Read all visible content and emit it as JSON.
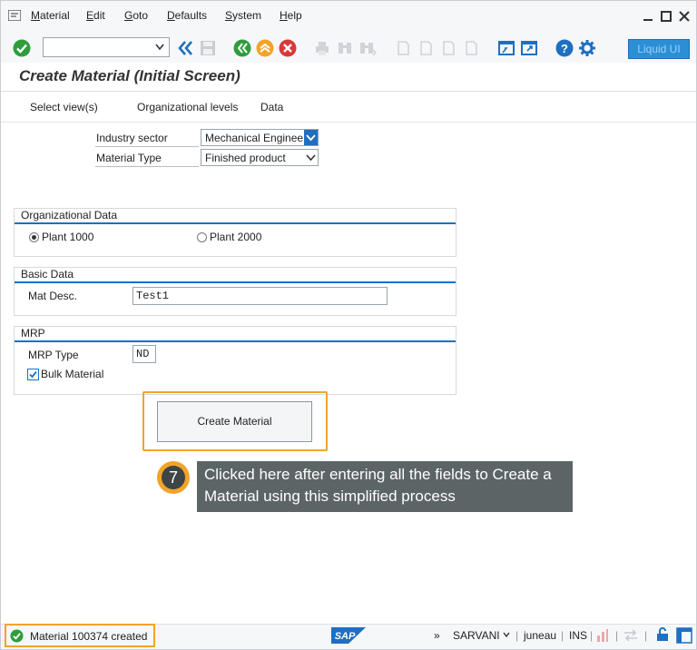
{
  "menubar": {
    "items": [
      {
        "label": "Material",
        "u": "M",
        "rest": "aterial"
      },
      {
        "label": "Edit",
        "u": "E",
        "rest": "dit"
      },
      {
        "label": "Goto",
        "u": "G",
        "rest": "oto"
      },
      {
        "label": "Defaults",
        "u": "D",
        "rest": "efaults"
      },
      {
        "label": "System",
        "u": "S",
        "rest": "ystem"
      },
      {
        "label": "Help",
        "u": "H",
        "rest": "elp"
      }
    ]
  },
  "toolbar": {
    "command_field_value": "",
    "liquid_ui_label": "Liquid UI",
    "icons": [
      "enter-icon",
      "back-arrows-icon",
      "save-icon",
      "back-icon",
      "exit-icon",
      "cancel-icon",
      "print-icon",
      "find-icon",
      "find-next-icon",
      "first-page-icon",
      "previous-page-icon",
      "next-page-icon",
      "last-page-icon",
      "new-session-icon",
      "shortcut-icon",
      "help-icon",
      "customize-icon"
    ]
  },
  "title": "Create Material (Initial Screen)",
  "appbar": {
    "select_views": "Select view(s)",
    "org_levels": "Organizational levels",
    "data": "Data"
  },
  "form": {
    "industry_sector_label": "Industry sector",
    "industry_sector_value": "Mechanical Enginee...",
    "material_type_label": "Material Type",
    "material_type_value": "Finished product"
  },
  "org_data": {
    "title": "Organizational Data",
    "plant1": "Plant 1000",
    "plant2": "Plant 2000",
    "selected": "Plant 1000"
  },
  "basic_data": {
    "title": "Basic Data",
    "mat_desc_label": "Mat Desc.",
    "mat_desc_value": "Test1"
  },
  "mrp": {
    "title": "MRP",
    "mrp_type_label": "MRP Type",
    "mrp_type_value": "ND",
    "bulk_label": "Bulk Material",
    "bulk_checked": true
  },
  "create_button": "Create Material",
  "annotation": {
    "step": "7",
    "text": "Clicked here after entering all the fields to Create a Material using this simplified process"
  },
  "statusbar": {
    "message": "Material 100374 created",
    "expand": "»",
    "system": "SARVANI",
    "server": "juneau",
    "mode": "INS",
    "sap_logo": "SAP"
  },
  "colors": {
    "accent_blue": "#1f6fc1",
    "highlight_orange": "#f1a42b",
    "ok_green": "#2e9e3b",
    "cancel_red": "#d9383a"
  }
}
